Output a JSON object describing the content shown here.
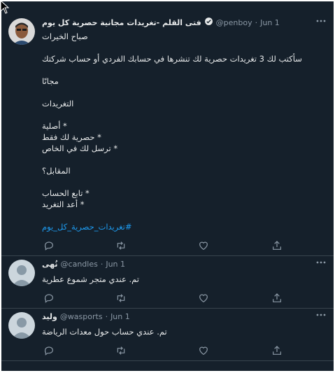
{
  "tweets": [
    {
      "name": "فتى القلم -تغريدات مجانية حصرية كل يوم",
      "verified": true,
      "handle": "@penboy",
      "separator": "·",
      "date": "Jun 1",
      "lines": [
        "صباح الخيرات",
        "",
        "سأكتب لك 3 تغريدات حصرية لك تنشرها في حسابك الفردي أو حساب شركتك",
        "",
        "مجانًا",
        "",
        "التغريدات",
        "",
        "* أصلية",
        "* حصرية لك فقط",
        "* ترسل لك في الخاص",
        "",
        "المقابل؟",
        "",
        "* تابع الحساب",
        "* أعد التغريد",
        ""
      ],
      "hashtag": "#تغريدات_حصرية_كل_يوم"
    },
    {
      "name": "نُهى",
      "verified": false,
      "handle": "@candles",
      "separator": "·",
      "date": "Jun 1",
      "lines": [
        "تم. عندي متجر شموع عطرية"
      ]
    },
    {
      "name": "وليد",
      "verified": false,
      "handle": "@wasports",
      "separator": "·",
      "date": "Jun 1",
      "lines": [
        "تم. عندي حساب حول معدات الرياضة"
      ]
    }
  ],
  "icons": {
    "more": "more-horizontal-icon",
    "reply": "reply-icon",
    "retweet": "retweet-icon",
    "like": "heart-icon",
    "share": "share-icon",
    "verified": "verified-badge-icon",
    "cursor": "mouse-cursor-icon"
  },
  "colors": {
    "background": "#15202b",
    "text": "#e7e9ea",
    "muted": "#8b98a5",
    "accent": "#1d9bf0",
    "divider": "#38444d"
  }
}
